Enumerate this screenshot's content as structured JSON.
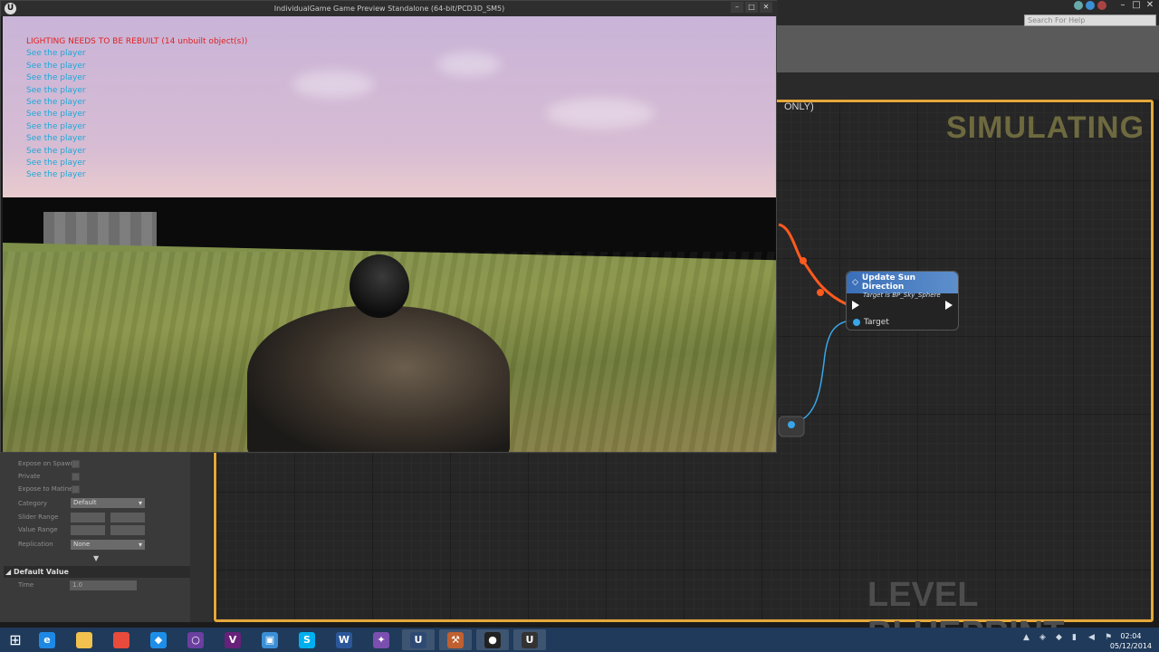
{
  "editor": {
    "help_search_placeholder": "Search For Help",
    "graph_tab_suffix": "ONLY)",
    "simulating_label": "SIMULATING",
    "level_blueprint_label": "LEVEL BLUEPRINT",
    "node": {
      "title": "Update Sun Direction",
      "subtitle": "Target is BP_Sky_Sphere",
      "pin_label": "Target"
    },
    "accent_color": "#e5a83a"
  },
  "details": {
    "rows": [
      {
        "label": "Expose on Spawn"
      },
      {
        "label": "Private"
      },
      {
        "label": "Expose to Matinee"
      },
      {
        "label": "Category",
        "value": "Default"
      },
      {
        "label": "Slider Range"
      },
      {
        "label": "Value Range"
      },
      {
        "label": "Replication",
        "value": "None"
      }
    ],
    "section_title": "Default Value",
    "time_label": "Time",
    "time_value": "1.0"
  },
  "game": {
    "window_title": "IndividualGame Game Preview Standalone (64-bit/PCD3D_SM5)",
    "logo_letter": "U",
    "warning": "LIGHTING NEEDS TO BE REBUILT (14 unbuilt object(s))",
    "debug_messages": [
      "See the player",
      "See the player",
      "See the player",
      "See the player",
      "See the player",
      "See the player",
      "See the player",
      "See the player",
      "See the player",
      "See the player",
      "See the player"
    ]
  },
  "taskbar": {
    "apps": [
      {
        "name": "internet-explorer",
        "glyph": "e",
        "color": "#1e88e5"
      },
      {
        "name": "file-explorer",
        "glyph": "",
        "color": "#f2c14e"
      },
      {
        "name": "chrome",
        "glyph": "",
        "color": "#e84a3c"
      },
      {
        "name": "dropbox",
        "glyph": "◆",
        "color": "#1d8ee8"
      },
      {
        "name": "app-circle",
        "glyph": "○",
        "color": "#6b3fa0"
      },
      {
        "name": "visual-studio",
        "glyph": "V",
        "color": "#68217a"
      },
      {
        "name": "remote-desktop",
        "glyph": "▣",
        "color": "#3a8fd6"
      },
      {
        "name": "skype",
        "glyph": "S",
        "color": "#00aff0"
      },
      {
        "name": "word",
        "glyph": "W",
        "color": "#2b579a"
      },
      {
        "name": "app-purple",
        "glyph": "✦",
        "color": "#7b4fb0"
      },
      {
        "name": "unreal-engine-a",
        "glyph": "U",
        "color": "#2e4a74"
      },
      {
        "name": "app-tools",
        "glyph": "⚒",
        "color": "#c06030"
      },
      {
        "name": "obs",
        "glyph": "●",
        "color": "#222222"
      },
      {
        "name": "unreal-engine-b",
        "glyph": "U",
        "color": "#333333"
      }
    ],
    "time": "02:04",
    "date": "05/12/2014"
  }
}
